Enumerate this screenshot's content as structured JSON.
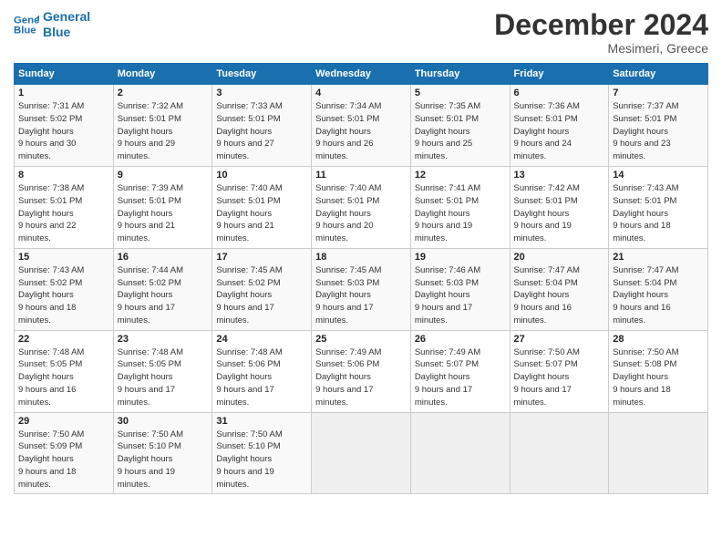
{
  "header": {
    "logo_line1": "General",
    "logo_line2": "Blue",
    "month": "December 2024",
    "location": "Mesimeri, Greece"
  },
  "weekdays": [
    "Sunday",
    "Monday",
    "Tuesday",
    "Wednesday",
    "Thursday",
    "Friday",
    "Saturday"
  ],
  "weeks": [
    [
      {
        "day": "1",
        "rise": "7:31 AM",
        "set": "5:02 PM",
        "daylight": "9 hours and 30 minutes."
      },
      {
        "day": "2",
        "rise": "7:32 AM",
        "set": "5:01 PM",
        "daylight": "9 hours and 29 minutes."
      },
      {
        "day": "3",
        "rise": "7:33 AM",
        "set": "5:01 PM",
        "daylight": "9 hours and 27 minutes."
      },
      {
        "day": "4",
        "rise": "7:34 AM",
        "set": "5:01 PM",
        "daylight": "9 hours and 26 minutes."
      },
      {
        "day": "5",
        "rise": "7:35 AM",
        "set": "5:01 PM",
        "daylight": "9 hours and 25 minutes."
      },
      {
        "day": "6",
        "rise": "7:36 AM",
        "set": "5:01 PM",
        "daylight": "9 hours and 24 minutes."
      },
      {
        "day": "7",
        "rise": "7:37 AM",
        "set": "5:01 PM",
        "daylight": "9 hours and 23 minutes."
      }
    ],
    [
      {
        "day": "8",
        "rise": "7:38 AM",
        "set": "5:01 PM",
        "daylight": "9 hours and 22 minutes."
      },
      {
        "day": "9",
        "rise": "7:39 AM",
        "set": "5:01 PM",
        "daylight": "9 hours and 21 minutes."
      },
      {
        "day": "10",
        "rise": "7:40 AM",
        "set": "5:01 PM",
        "daylight": "9 hours and 21 minutes."
      },
      {
        "day": "11",
        "rise": "7:40 AM",
        "set": "5:01 PM",
        "daylight": "9 hours and 20 minutes."
      },
      {
        "day": "12",
        "rise": "7:41 AM",
        "set": "5:01 PM",
        "daylight": "9 hours and 19 minutes."
      },
      {
        "day": "13",
        "rise": "7:42 AM",
        "set": "5:01 PM",
        "daylight": "9 hours and 19 minutes."
      },
      {
        "day": "14",
        "rise": "7:43 AM",
        "set": "5:01 PM",
        "daylight": "9 hours and 18 minutes."
      }
    ],
    [
      {
        "day": "15",
        "rise": "7:43 AM",
        "set": "5:02 PM",
        "daylight": "9 hours and 18 minutes."
      },
      {
        "day": "16",
        "rise": "7:44 AM",
        "set": "5:02 PM",
        "daylight": "9 hours and 17 minutes."
      },
      {
        "day": "17",
        "rise": "7:45 AM",
        "set": "5:02 PM",
        "daylight": "9 hours and 17 minutes."
      },
      {
        "day": "18",
        "rise": "7:45 AM",
        "set": "5:03 PM",
        "daylight": "9 hours and 17 minutes."
      },
      {
        "day": "19",
        "rise": "7:46 AM",
        "set": "5:03 PM",
        "daylight": "9 hours and 17 minutes."
      },
      {
        "day": "20",
        "rise": "7:47 AM",
        "set": "5:04 PM",
        "daylight": "9 hours and 16 minutes."
      },
      {
        "day": "21",
        "rise": "7:47 AM",
        "set": "5:04 PM",
        "daylight": "9 hours and 16 minutes."
      }
    ],
    [
      {
        "day": "22",
        "rise": "7:48 AM",
        "set": "5:05 PM",
        "daylight": "9 hours and 16 minutes."
      },
      {
        "day": "23",
        "rise": "7:48 AM",
        "set": "5:05 PM",
        "daylight": "9 hours and 17 minutes."
      },
      {
        "day": "24",
        "rise": "7:48 AM",
        "set": "5:06 PM",
        "daylight": "9 hours and 17 minutes."
      },
      {
        "day": "25",
        "rise": "7:49 AM",
        "set": "5:06 PM",
        "daylight": "9 hours and 17 minutes."
      },
      {
        "day": "26",
        "rise": "7:49 AM",
        "set": "5:07 PM",
        "daylight": "9 hours and 17 minutes."
      },
      {
        "day": "27",
        "rise": "7:50 AM",
        "set": "5:07 PM",
        "daylight": "9 hours and 17 minutes."
      },
      {
        "day": "28",
        "rise": "7:50 AM",
        "set": "5:08 PM",
        "daylight": "9 hours and 18 minutes."
      }
    ],
    [
      {
        "day": "29",
        "rise": "7:50 AM",
        "set": "5:09 PM",
        "daylight": "9 hours and 18 minutes."
      },
      {
        "day": "30",
        "rise": "7:50 AM",
        "set": "5:10 PM",
        "daylight": "9 hours and 19 minutes."
      },
      {
        "day": "31",
        "rise": "7:50 AM",
        "set": "5:10 PM",
        "daylight": "9 hours and 19 minutes."
      },
      null,
      null,
      null,
      null
    ]
  ]
}
